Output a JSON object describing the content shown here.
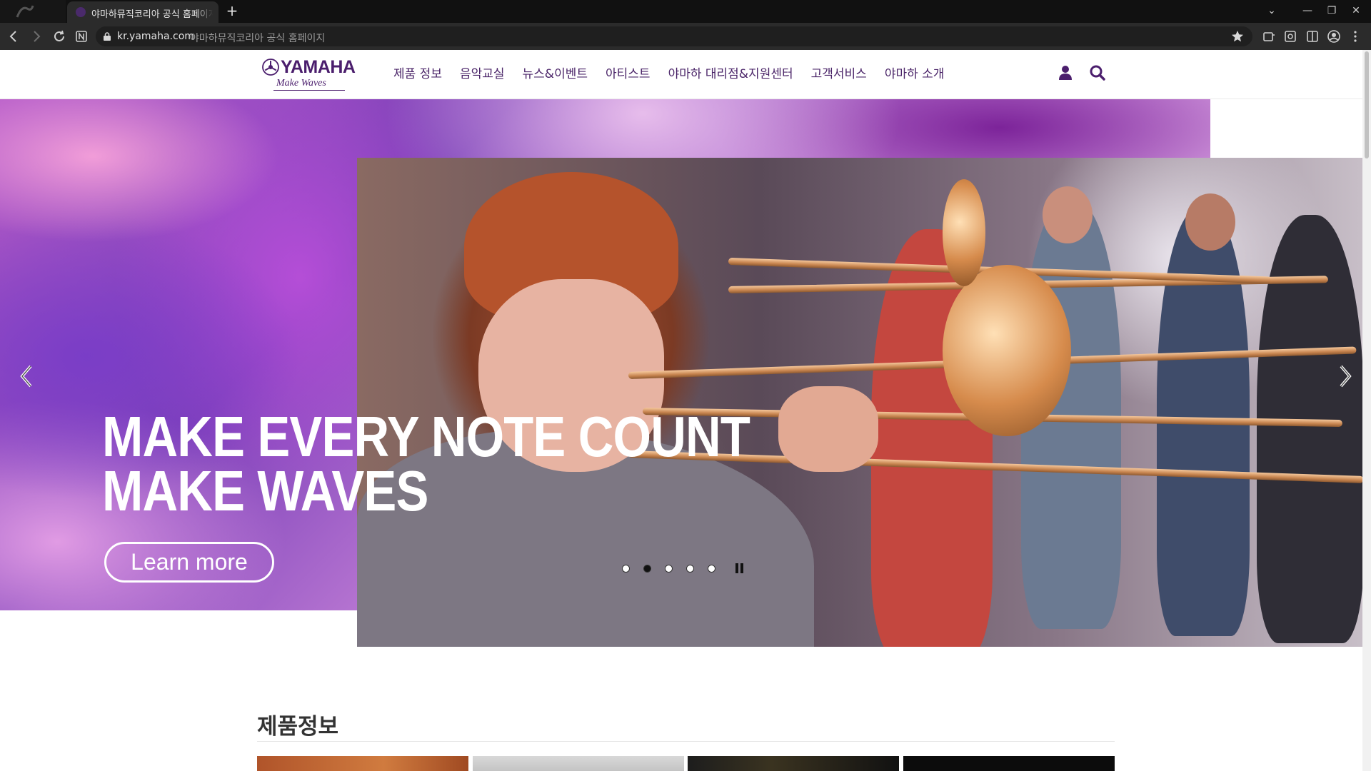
{
  "browser": {
    "active_tab_title": "야마하뮤직코리아 공식 홈페이지",
    "new_tab_label": "+",
    "url_host": "kr.yamaha.com",
    "url_page_title": "야마하뮤직코리아 공식 홈페이지",
    "window_controls": {
      "chevron": "⌄",
      "minimize": "—",
      "restore": "❐",
      "close": "✕"
    }
  },
  "header": {
    "logo_brand": "YAMAHA",
    "logo_tagline": "Make Waves",
    "nav": [
      {
        "label": "제품 정보"
      },
      {
        "label": "음악교실"
      },
      {
        "label": "뉴스&이벤트"
      },
      {
        "label": "아티스트"
      },
      {
        "label": "야마하 대리점&지원센터"
      },
      {
        "label": "고객서비스"
      },
      {
        "label": "야마하 소개"
      }
    ],
    "icons": [
      "user-icon",
      "search-icon"
    ]
  },
  "hero": {
    "headline_line1": "MAKE EVERY NOTE COUNT",
    "headline_line2": "MAKE WAVES",
    "cta_label": "Learn more",
    "slide_count": 5,
    "active_slide": 2
  },
  "products": {
    "section_title": "제품정보"
  },
  "colors": {
    "brand_purple": "#4b1e6d",
    "chrome_dark": "#2b2b2b",
    "tabbar": "#111111"
  }
}
